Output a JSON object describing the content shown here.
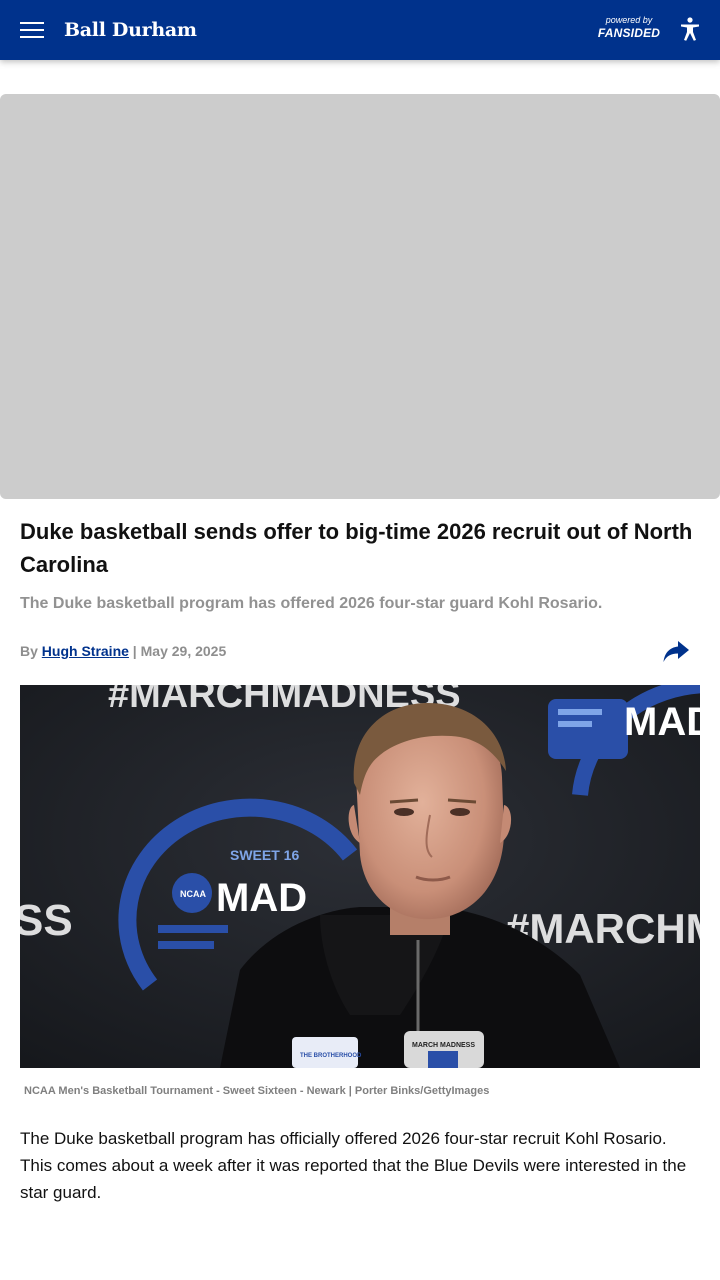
{
  "header": {
    "site_name": "Ball Durham",
    "powered_by": "powered by",
    "network_name": "FANSIDED",
    "menu_icon": "hamburger-menu-icon",
    "accessibility_icon": "accessibility-icon",
    "background_color": "#00328c"
  },
  "ad": {
    "placeholder_color": "#cccccc"
  },
  "article": {
    "headline": "Duke basketball sends offer to big-time 2026 recruit out of North Carolina",
    "subheadline": "The Duke basketball program has offered 2026 four-star guard Kohl Rosario.",
    "byline": {
      "prefix": "By ",
      "author": "Hugh Straine",
      "separator": " | ",
      "date": "May 29, 2025"
    },
    "share_icon": "share-arrow-icon",
    "image": {
      "alt": "Duke head coach at NCAA March Madness press conference",
      "backdrop_text_1": "#MARCHMADNESS",
      "backdrop_text_2": "#MARCHM",
      "backdrop_logo_text": "MAD",
      "backdrop_sweet": "SWEET 16",
      "mic_label": "MARCH MADNESS",
      "hoodie_label": "THE BROTHERHOOD",
      "caption": "NCAA Men's Basketball Tournament - Sweet Sixteen - Newark | Porter Binks/GettyImages"
    },
    "body_paragraph_1": "The Duke basketball program has officially offered 2026 four-star recruit Kohl Rosario. This comes about a week after it was reported that the Blue Devils were interested in the star guard."
  }
}
